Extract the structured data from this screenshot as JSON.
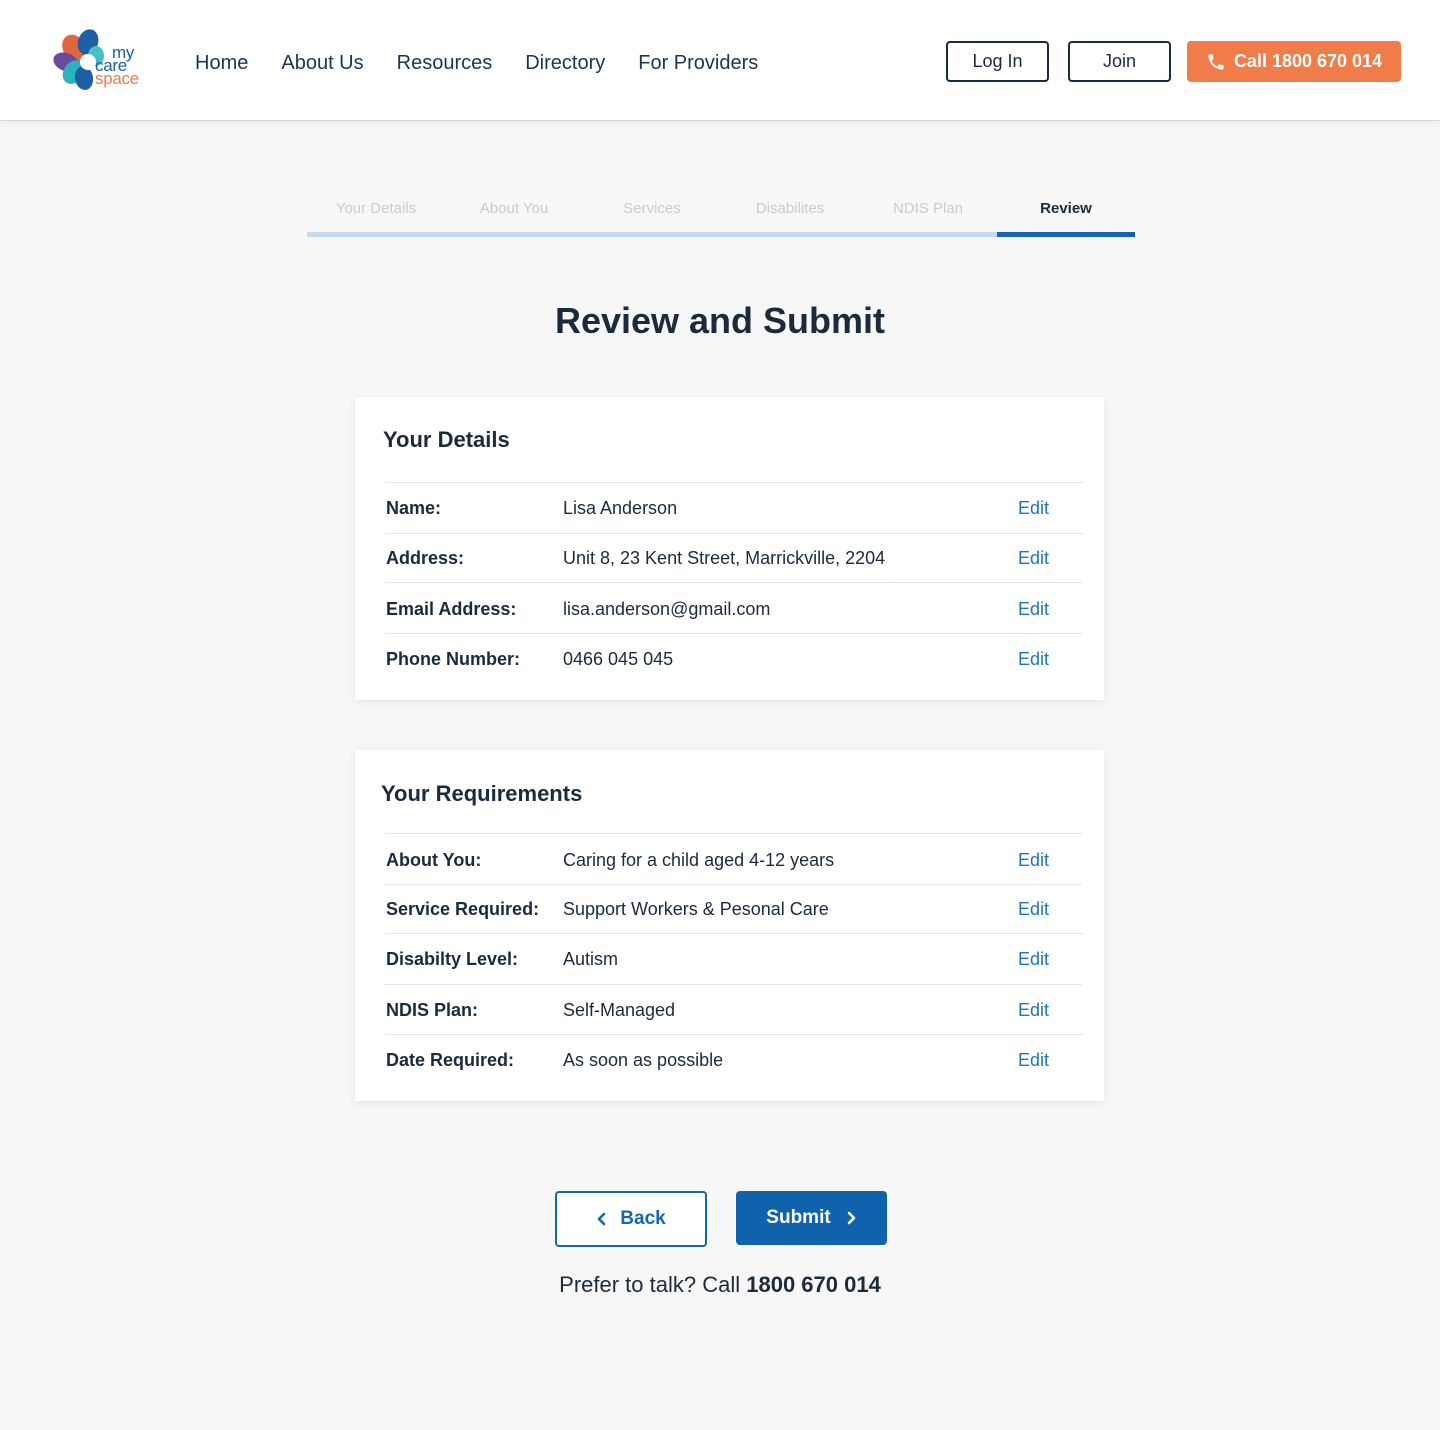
{
  "logo": {
    "line1": "my",
    "line2": "care",
    "line3": "space"
  },
  "nav": [
    "Home",
    "About Us",
    "Resources",
    "Directory",
    "For Providers"
  ],
  "header": {
    "login_label": "Log In",
    "join_label": "Join",
    "call_label": "Call 1800 670 014",
    "call_icon": "phone-icon"
  },
  "steps": [
    "Your Details",
    "About You",
    "Services",
    "Disabilites",
    "NDIS Plan",
    "Review"
  ],
  "active_step": "Review",
  "title": "Review and Submit",
  "details": {
    "title": "Your Details",
    "rows": [
      {
        "label": "Name:",
        "value": "Lisa Anderson",
        "action": "Edit"
      },
      {
        "label": "Address:",
        "value": "Unit 8, 23 Kent Street, Marrickville, 2204",
        "action": "Edit"
      },
      {
        "label": "Email Address:",
        "value": "lisa.anderson@gmail.com",
        "action": "Edit"
      },
      {
        "label": "Phone Number:",
        "value": "0466 045 045",
        "action": "Edit"
      }
    ]
  },
  "requirements": {
    "title": "Your Requirements",
    "rows": [
      {
        "label": "About You:",
        "value": "Caring for a child aged 4-12 years",
        "action": "Edit"
      },
      {
        "label": "Service Required:",
        "value": "Support Workers & Pesonal Care",
        "action": "Edit"
      },
      {
        "label": "Disabilty Level:",
        "value": "Autism",
        "action": "Edit"
      },
      {
        "label": "NDIS Plan:",
        "value": "Self-Managed",
        "action": "Edit"
      },
      {
        "label": "Date Required:",
        "value": "As soon as possible",
        "action": "Edit"
      }
    ]
  },
  "actions": {
    "back_label": "Back",
    "submit_label": "Submit"
  },
  "talk": {
    "prefix": "Prefer to talk? Call",
    "number": "1800 670 014"
  },
  "colors": {
    "accent": "#1467ad",
    "call": "#f07c4a",
    "link": "#1f75bd"
  }
}
